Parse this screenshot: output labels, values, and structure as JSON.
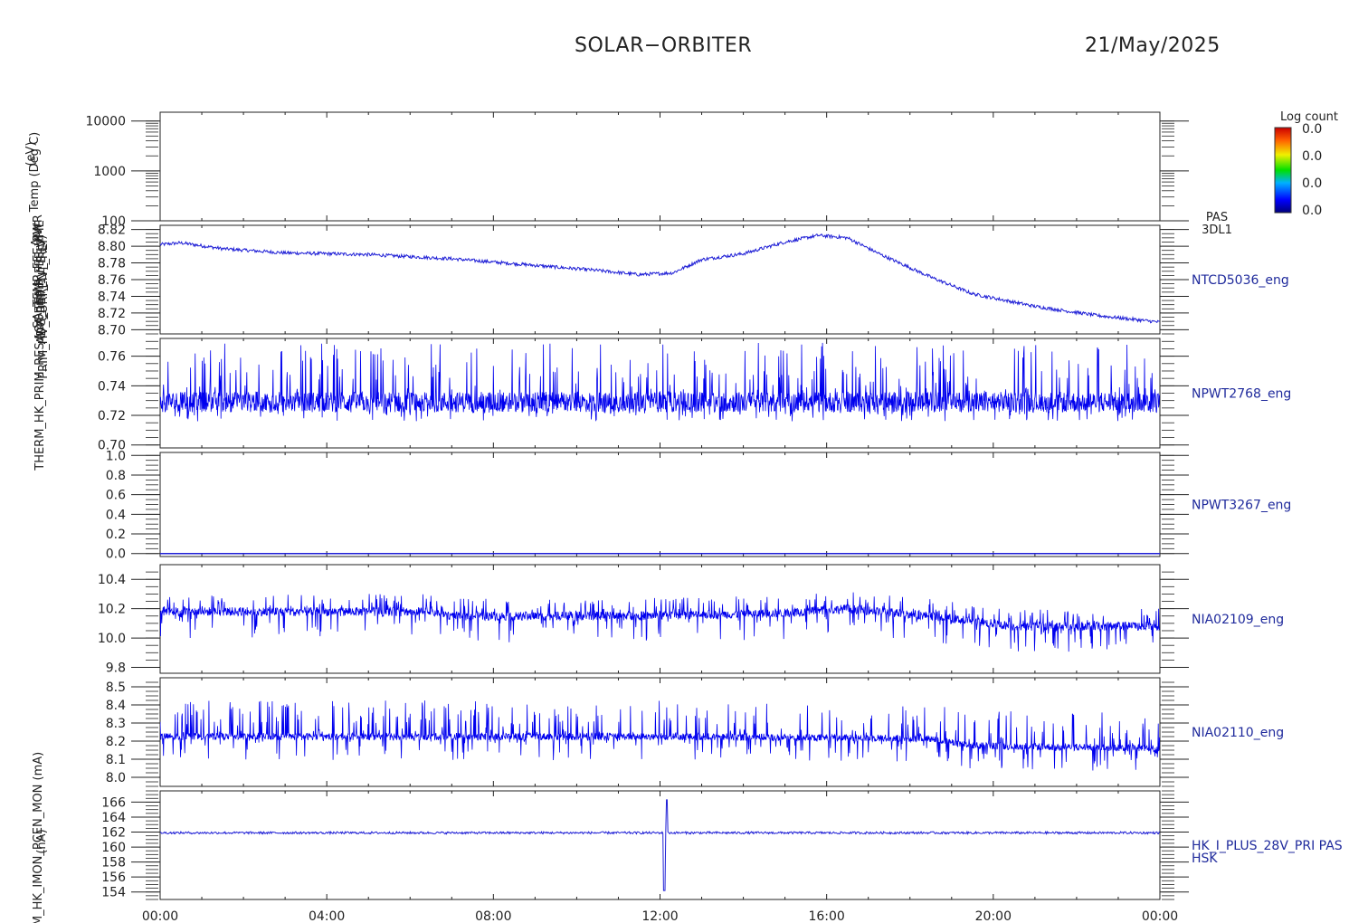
{
  "header": {
    "title": "SOLAR−ORBITER",
    "date": "21/May/2025"
  },
  "colorbar": {
    "title": "Log count",
    "labels": [
      "0.0",
      "0.0",
      "0.0",
      "0.0"
    ]
  },
  "y_axis_overlap_labels": [
    "(eV)",
    "Temp (Deg C)",
    "Apx",
    "SA_TEMP_FEE_PWR",
    "ACA_TEMP_FEE_VME",
    "ADC_REF_1V_E (V)",
    "PRIM_HV_CURRENT_REF",
    "THERM_HK_PRIM_RES (mOhm)",
    "(nA)",
    "PSDM_HK_IMON_PCEN_MON (mA)"
  ],
  "chart_data": {
    "type": "line",
    "x_range_hours": [
      0,
      24
    ],
    "x_ticks": [
      {
        "h": 0,
        "label": "00:00"
      },
      {
        "h": 4,
        "label": "04:00"
      },
      {
        "h": 8,
        "label": "08:00"
      },
      {
        "h": 12,
        "label": "12:00"
      },
      {
        "h": 16,
        "label": "16:00"
      },
      {
        "h": 20,
        "label": "20:00"
      },
      {
        "h": 24,
        "label": "00:00"
      }
    ],
    "panels": [
      {
        "id": "pas-3dl1",
        "kind": "spectrogram",
        "log": true,
        "ylim": [
          100,
          15000
        ],
        "yticks": [
          100,
          1000,
          10000
        ],
        "yticklabels": [
          "100",
          "1000",
          "10000"
        ],
        "right_label": [
          "PAS",
          "3DL1"
        ],
        "series": []
      },
      {
        "id": "ntcd5036",
        "kind": "line",
        "ylim": [
          8.695,
          8.825
        ],
        "yticks": [
          8.7,
          8.72,
          8.74,
          8.76,
          8.78,
          8.8,
          8.82
        ],
        "yticklabels": [
          "8.70",
          "8.72",
          "8.74",
          "8.76",
          "8.78",
          "8.80",
          "8.82"
        ],
        "right_label": [
          "NTCD5036_eng"
        ],
        "trend_h": [
          0,
          0.5,
          1.5,
          3,
          5,
          7,
          9,
          10.5,
          11.5,
          12.3,
          13,
          14,
          15,
          15.8,
          16.5,
          17.3,
          18.5,
          19.5,
          21,
          22.5,
          24
        ],
        "trend_v": [
          8.802,
          8.804,
          8.797,
          8.792,
          8.79,
          8.785,
          8.777,
          8.771,
          8.766,
          8.768,
          8.784,
          8.791,
          8.805,
          8.813,
          8.81,
          8.79,
          8.763,
          8.743,
          8.728,
          8.717,
          8.709
        ],
        "noise": 0.002
      },
      {
        "id": "npwt2768",
        "kind": "noise",
        "ylim": [
          0.698,
          0.772
        ],
        "yticks": [
          0.7,
          0.72,
          0.74,
          0.76
        ],
        "yticklabels": [
          "0.70",
          "0.72",
          "0.74",
          "0.76"
        ],
        "right_label": [
          "NPWT2768_eng"
        ],
        "base": 0.729,
        "band": 0.007,
        "spikes_up": 0.04,
        "spikes_down": 0.013
      },
      {
        "id": "npwt3267",
        "kind": "flat",
        "ylim": [
          -0.03,
          1.03
        ],
        "yticks": [
          0.0,
          0.2,
          0.4,
          0.6,
          0.8,
          1.0
        ],
        "yticklabels": [
          "0.0",
          "0.2",
          "0.4",
          "0.6",
          "0.8",
          "1.0"
        ],
        "right_label": [
          "NPWT3267_eng"
        ],
        "value": 0.0
      },
      {
        "id": "nia02109",
        "kind": "noise",
        "ylim": [
          9.76,
          10.5
        ],
        "yticks": [
          9.8,
          10.0,
          10.2,
          10.4
        ],
        "yticklabels": [
          "9.8",
          "10.0",
          "10.2",
          "10.4"
        ],
        "right_label": [
          "NIA02109_eng"
        ],
        "base_h": [
          0,
          3,
          6.5,
          7,
          11,
          13.3,
          15,
          16.5,
          18.5,
          20.5,
          24
        ],
        "base_v": [
          10.18,
          10.18,
          10.18,
          10.15,
          10.15,
          10.16,
          10.17,
          10.2,
          10.15,
          10.08,
          10.08
        ],
        "band": 0.03,
        "spikes_up": 0.12,
        "spikes_down": 0.18
      },
      {
        "id": "nia02110",
        "kind": "noise",
        "ylim": [
          7.95,
          8.55
        ],
        "yticks": [
          8.0,
          8.1,
          8.2,
          8.3,
          8.4,
          8.5
        ],
        "yticklabels": [
          "8.0",
          "8.1",
          "8.2",
          "8.3",
          "8.4",
          "8.5"
        ],
        "right_label": [
          "NIA02110_eng"
        ],
        "base_h": [
          0,
          12,
          18.5,
          19.5,
          24
        ],
        "base_v": [
          8.225,
          8.225,
          8.215,
          8.175,
          8.16
        ],
        "band": 0.02,
        "spikes_up": 0.2,
        "spikes_down": 0.13
      },
      {
        "id": "hk-i-plus",
        "kind": "line_spike",
        "ylim": [
          153,
          167.5
        ],
        "yticks": [
          154,
          156,
          158,
          160,
          162,
          164,
          166
        ],
        "yticklabels": [
          "154",
          "156",
          "158",
          "160",
          "162",
          "164",
          "166"
        ],
        "right_label": [
          "HK_I_PLUS_28V_PRI PAS",
          "HSK"
        ],
        "value": 161.9,
        "noise": 0.15,
        "spike": {
          "h": 12.1,
          "low": 154.2,
          "high": 166.3
        }
      }
    ]
  }
}
